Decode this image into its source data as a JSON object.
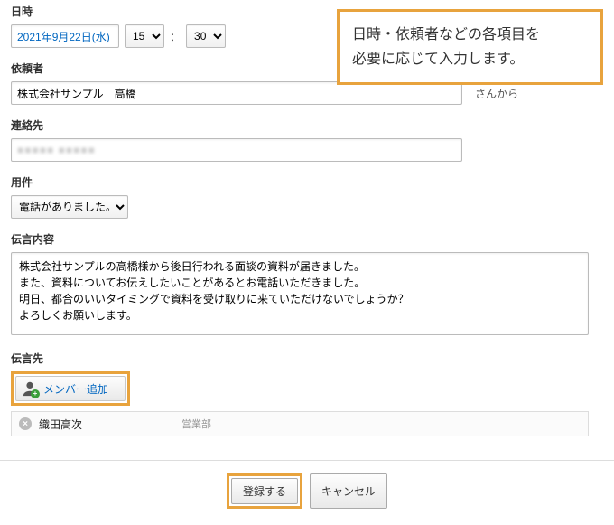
{
  "callout": {
    "line1": "日時・依頼者などの各項目を",
    "line2": "必要に応じて入力します。"
  },
  "datetime": {
    "label": "日時",
    "date_value": "2021年9月22日(水)",
    "hour": "15",
    "minute": "30",
    "separator": "："
  },
  "requester": {
    "label": "依頼者",
    "value": "株式会社サンプル　高橋",
    "suffix": "さんから"
  },
  "contact": {
    "label": "連絡先",
    "placeholder_display": "■■■■■ ■■■■■"
  },
  "purpose": {
    "label": "用件",
    "selected": "電話がありました。"
  },
  "message": {
    "label": "伝言内容",
    "text": "株式会社サンプルの高橋様から後日行われる面談の資料が届きました。\nまた、資料についてお伝えしたいことがあるとお電話いただきました。\n明日、都合のいいタイミングで資料を受け取りに来ていただけないでしょうか？\nよろしくお願いします。"
  },
  "recipients": {
    "label": "伝言先",
    "add_button": "メンバー追加",
    "list": [
      {
        "name": "織田高次",
        "dept": "営業部"
      }
    ]
  },
  "actions": {
    "submit": "登録する",
    "cancel": "キャンセル"
  }
}
